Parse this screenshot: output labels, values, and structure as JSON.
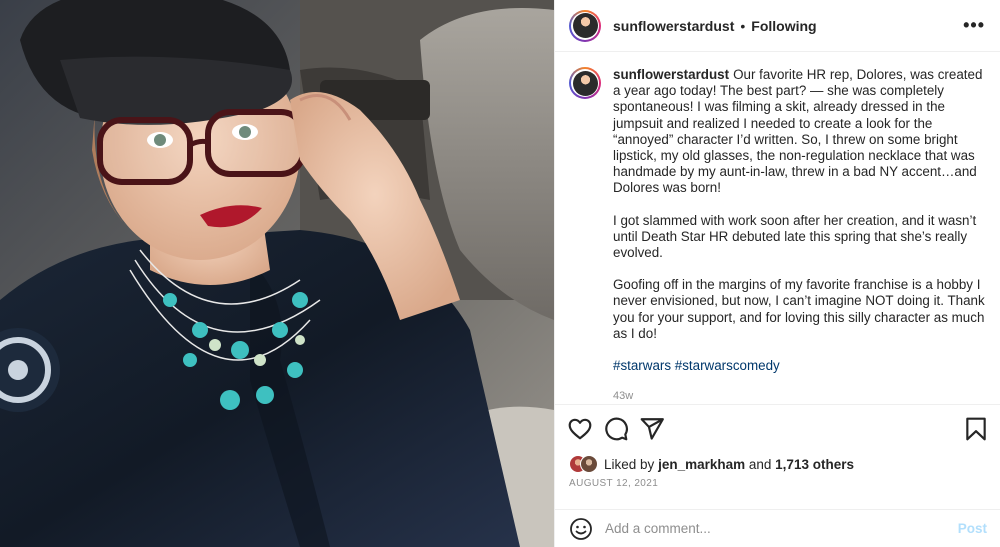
{
  "photo": {
    "alt_subject": "selfie-woman-in-cap-glasses-turquoise-necklace"
  },
  "header": {
    "username": "sunflowerstardust",
    "separator": "•",
    "follow_state": "Following",
    "more_icon": "more-horizontal-icon"
  },
  "caption": {
    "username": "sunflowerstardust",
    "paragraphs": [
      "Our favorite HR rep, Dolores, was created a year ago today! The best part? — she was completely spontaneous! I was filming a skit, already dressed in the jumpsuit and realized I needed to create a look for the “annoyed” character I’d written. So, I threw on some bright lipstick, my old glasses, the non-regulation necklace that was handmade by my aunt-in-law, threw in a bad NY accent…and Dolores was born!",
      "I got slammed with work soon after her creation, and it wasn’t until Death Star HR debuted late this spring that she’s really evolved.",
      "Goofing off in the margins of my favorite franchise is a hobby I never envisioned, but now, I can’t imagine NOT doing it. Thank you for your support, and for loving this silly character as much as I do!"
    ],
    "hashtags": [
      "#starwars",
      "#starwarscomedy"
    ],
    "time_ago": "43w"
  },
  "actions": {
    "icons": [
      "heart-icon",
      "comment-icon",
      "share-icon",
      "bookmark-icon"
    ]
  },
  "likes": {
    "prefix": "Liked by",
    "user": "jen_markham",
    "connector": "and",
    "others": "1,713 others"
  },
  "date": "AUGUST 12, 2021",
  "comment": {
    "placeholder": "Add a comment...",
    "post_label": "Post"
  },
  "colors": {
    "text": "#262626",
    "muted": "#8e8e8e",
    "hashtag": "#00376b",
    "post_disabled": "#b2dffc",
    "divider": "#efefef"
  }
}
